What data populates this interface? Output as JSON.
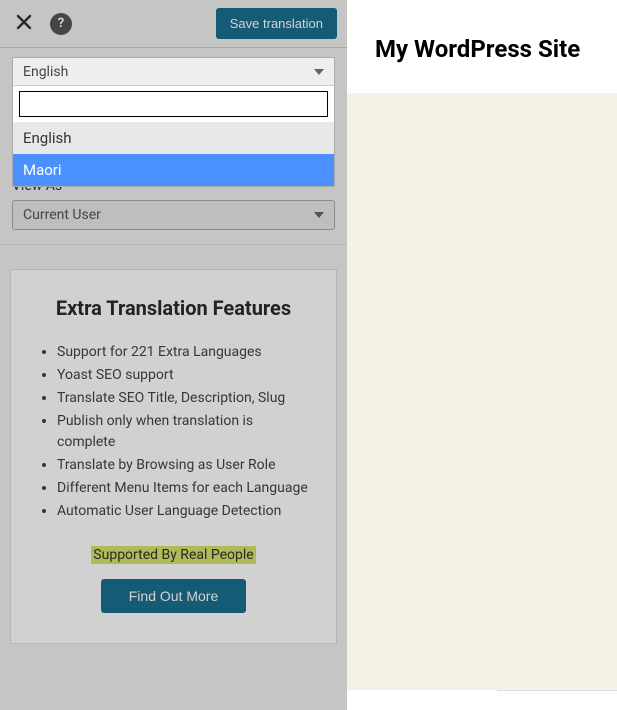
{
  "topbar": {
    "save_label": "Save translation"
  },
  "language_select": {
    "selected": "English",
    "search_value": "",
    "options": [
      "English",
      "Maori"
    ]
  },
  "view_as": {
    "label": "View As",
    "selected": "Current User"
  },
  "features": {
    "title": "Extra Translation Features",
    "items": [
      "Support for 221 Extra Languages",
      "Yoast SEO support",
      "Translate SEO Title, Description, Slug",
      "Publish only when translation is complete",
      "Translate by Browsing as User Role",
      "Different Menu Items for each Language",
      "Automatic User Language Detection"
    ],
    "supported": "Supported By Real People",
    "cta": "Find Out More"
  },
  "site": {
    "title": "My WordPress Site"
  }
}
